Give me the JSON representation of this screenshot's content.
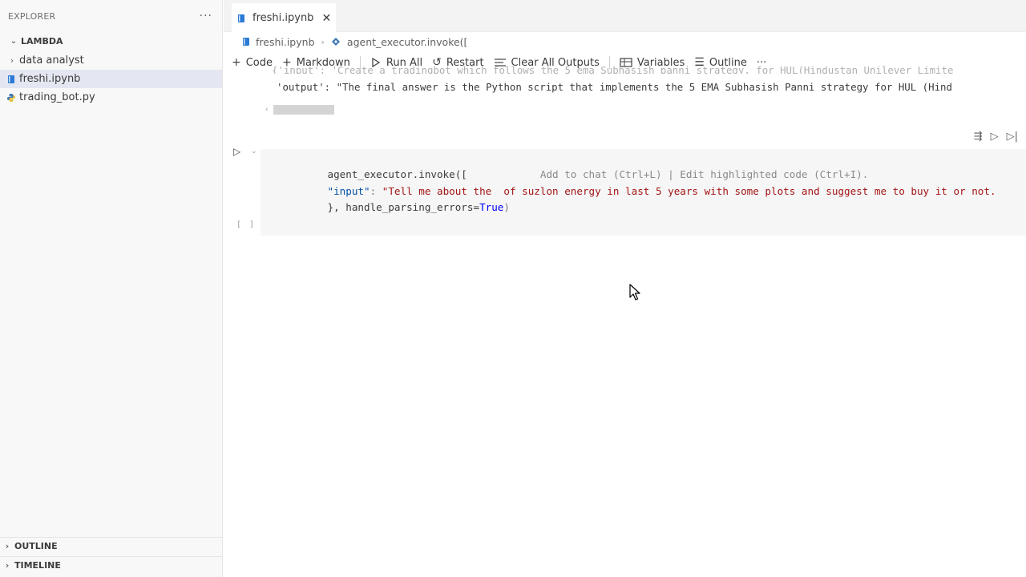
{
  "sidebar": {
    "title": "EXPLORER",
    "more": "···",
    "root": "LAMBDA",
    "items": [
      {
        "label": "data analyst",
        "type": "folder"
      },
      {
        "label": "freshi.ipynb",
        "type": "notebook",
        "selected": true
      },
      {
        "label": "trading_bot.py",
        "type": "python"
      }
    ],
    "sections": [
      "OUTLINE",
      "TIMELINE"
    ]
  },
  "editor": {
    "tab": {
      "label": "freshi.ipynb",
      "close": "✕"
    },
    "breadcrumb": [
      "freshi.ipynb",
      "agent_executor.invoke(["
    ],
    "toolbar": {
      "code": "Code",
      "markdown": "Markdown",
      "run_all": "Run All",
      "restart": "Restart",
      "clear_outputs": "Clear All Outputs",
      "variables": "Variables",
      "outline": "Outline",
      "more": "···"
    },
    "output": {
      "line_input_partial": "{'input': 'Create a tradingbot which follows the 5 ema Subhasish panni strategy, for HUL(Hindustan Unilever Limite",
      "line_output": "'output': \"The final answer is the Python script that implements the 5 EMA Subhasish Panni strategy for HUL (Hind"
    },
    "cell": {
      "line1_code": "agent_executor.invoke([",
      "line1_hint": "Add to chat (Ctrl+L) | Edit highlighted code (Ctrl+I).",
      "line2_key": "\"input\"",
      "line2_colon": ": ",
      "line2_str": "\"Tell me about the  of suzlon energy in last 5 years with some plots and suggest me to buy it or not.",
      "line3_code": "}, handle_parsing_errors=",
      "line3_const": "True",
      "line3_close": ")",
      "status": "[ ]"
    }
  },
  "colors": {
    "accent": "#007acc",
    "selection": "#e4e6f1",
    "string": "#a31515",
    "key": "#0451a5",
    "constant": "#0000ff"
  }
}
